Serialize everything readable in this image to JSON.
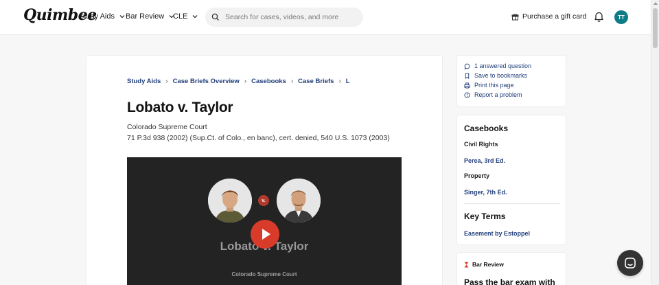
{
  "header": {
    "logo": "Quimbee",
    "nav": [
      {
        "label": "Study Aids"
      },
      {
        "label": "Bar Review"
      },
      {
        "label": "CLE"
      }
    ],
    "search": {
      "placeholder": "Search for cases, videos, and more"
    },
    "gift_label": "Purchase a gift card",
    "avatar_initials": "TT",
    "avatar_color": "#0e7c86"
  },
  "breadcrumb": [
    "Study Aids",
    "Case Briefs Overview",
    "Casebooks",
    "Case Briefs",
    "L"
  ],
  "case": {
    "title": "Lobato v. Taylor",
    "court": "Colorado Supreme Court",
    "citation": "71 P.3d 938 (2002) (Sup.Ct. of Colo., en banc), cert. denied, 540 U.S. 1073 (2003)"
  },
  "video": {
    "vs_label": "v.",
    "title": "Lobato v. Taylor",
    "subtitle": "Colorado Supreme Court",
    "play_color": "#d93b2b"
  },
  "actions": [
    {
      "label": "1 answered question",
      "icon": "chat-bubble-icon"
    },
    {
      "label": "Save to bookmarks",
      "icon": "bookmark-icon"
    },
    {
      "label": "Print this page",
      "icon": "printer-icon"
    },
    {
      "label": "Report a problem",
      "icon": "alert-circle-icon"
    }
  ],
  "casebooks": {
    "heading": "Casebooks",
    "groups": [
      {
        "category": "Civil Rights",
        "book": "Perea, 3rd Ed."
      },
      {
        "category": "Property",
        "book": "Singer, 7th Ed."
      }
    ],
    "key_terms_heading": "Key Terms",
    "key_terms": [
      "Easement by Estoppel"
    ]
  },
  "bar_review": {
    "label": "Bar Review",
    "title": "Pass the bar exam with"
  },
  "colors": {
    "link": "#1f3d7a",
    "accent_red": "#d93b2b"
  }
}
